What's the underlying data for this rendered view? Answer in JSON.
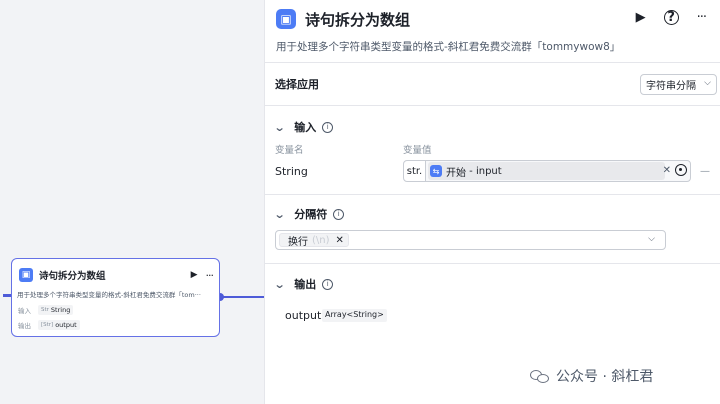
{
  "node": {
    "title": "诗句拆分为数组",
    "description": "用于处理多个字符串类型变量的格式-斜杠君免费交流群「tom···",
    "input_label": "输入",
    "input_type_abbr": "Str",
    "input_value": "String",
    "output_label": "输出",
    "output_type_abbr": "[Str]",
    "output_value": "output"
  },
  "panel": {
    "title": "诗句拆分为数组",
    "description": "用于处理多个字符串类型变量的格式-斜杠君免费交流群「tommywow8」",
    "select_app": {
      "label": "选择应用",
      "value": "字符串分隔"
    },
    "input_section": {
      "title": "输入",
      "col_name": "变量名",
      "col_value": "变量值",
      "var_name": "String",
      "var_type": "str.",
      "ref_source": "开始",
      "ref_sep": " - ",
      "ref_var": "input"
    },
    "separator_section": {
      "title": "分隔符",
      "tag_label": "换行",
      "tag_sub": "(\\n)"
    },
    "output_section": {
      "title": "输出",
      "var_name": "output",
      "var_type": "Array<String>"
    }
  },
  "watermark": {
    "text": "公众号 · 斜杠君"
  },
  "icons": {
    "node_logo": "app-icon",
    "run": "play-icon",
    "more": "more-icon",
    "help": "help-icon",
    "chevron": "chevron-down-icon",
    "info": "info-icon",
    "clear": "close-icon",
    "pick_var": "target-icon",
    "watermark_logo": "wechat-icon"
  },
  "colors": {
    "accent": "#4e5bd8",
    "logo": "#4d7cf5"
  }
}
